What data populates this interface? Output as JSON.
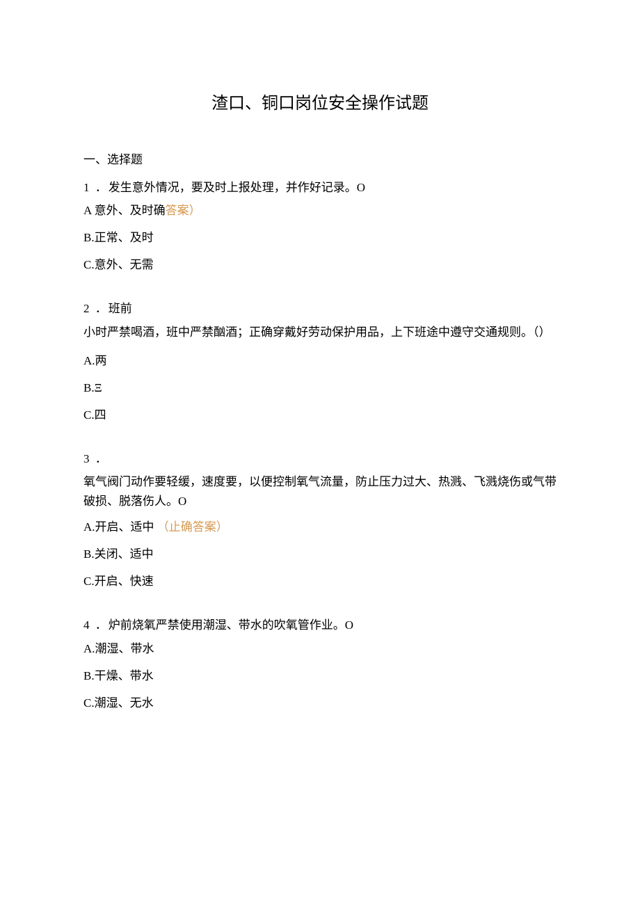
{
  "title": "渣口、铜口岗位安全操作试题",
  "section_label": "一、选择题",
  "q1": {
    "num": "1 ．",
    "stem": "发生意外情况，要及时上报处理，并作好记录。O",
    "optA_prefix": "A 意外、及时确",
    "optA_mark": "答案）",
    "optB": "B.正常、及时",
    "optC": "C.意外、无需"
  },
  "q2": {
    "num": "2 ．",
    "stem1": "班前",
    "stem2": "小时严禁喝酒，班中严禁酗酒；正确穿戴好劳动保护用品，上下班途中遵守交通规则。（）",
    "optA": "A.两",
    "optB": "B.Ξ",
    "optC": "C.四"
  },
  "q3": {
    "num": "3 ．",
    "stem": "氧气阀门动作要轻缓，速度要，以便控制氧气流量，防止压力过大、热溅、飞溅烧伤或气带破损、脱落伤人。O",
    "optA_prefix": "A.开启、适中 ",
    "optA_mark": "（止确答案）",
    "optB": "B.关闭、适中",
    "optC": "C.开启、快速"
  },
  "q4": {
    "num": "4 ．",
    "stem": "炉前烧氧严禁使用潮湿、带水的吹氧管作业。O",
    "optA": "A.潮湿、带水",
    "optB": "B.干燥、带水",
    "optC": "C.潮湿、无水"
  }
}
